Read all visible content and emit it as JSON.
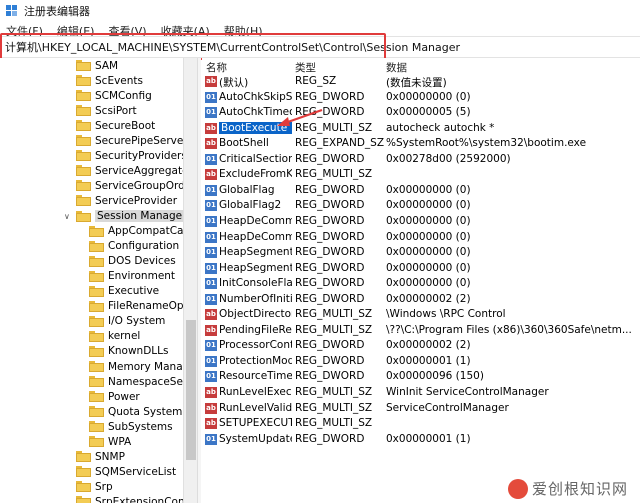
{
  "window": {
    "title": "注册表编辑器"
  },
  "menu": [
    "文件(F)",
    "编辑(E)",
    "查看(V)",
    "收藏夹(A)",
    "帮助(H)"
  ],
  "address": "计算机\\HKEY_LOCAL_MACHINE\\SYSTEM\\CurrentControlSet\\Control\\Session Manager",
  "tree": [
    {
      "label": "SAM",
      "level": 0
    },
    {
      "label": "ScEvents",
      "level": 0
    },
    {
      "label": "SCMConfig",
      "level": 0
    },
    {
      "label": "ScsiPort",
      "level": 0
    },
    {
      "label": "SecureBoot",
      "level": 0
    },
    {
      "label": "SecurePipeServers",
      "level": 0
    },
    {
      "label": "SecurityProviders",
      "level": 0
    },
    {
      "label": "ServiceAggregatedEv",
      "level": 0
    },
    {
      "label": "ServiceGroupOrder",
      "level": 0
    },
    {
      "label": "ServiceProvider",
      "level": 0
    },
    {
      "label": "Session Manager",
      "level": 0,
      "selected": true,
      "expanded": true
    },
    {
      "label": "AppCompatCache",
      "level": 1
    },
    {
      "label": "Configuration Mar",
      "level": 1
    },
    {
      "label": "DOS Devices",
      "level": 1
    },
    {
      "label": "Environment",
      "level": 1
    },
    {
      "label": "Executive",
      "level": 1
    },
    {
      "label": "FileRenameOperat",
      "level": 1
    },
    {
      "label": "I/O System",
      "level": 1
    },
    {
      "label": "kernel",
      "level": 1
    },
    {
      "label": "KnownDLLs",
      "level": 1
    },
    {
      "label": "Memory Managen",
      "level": 1
    },
    {
      "label": "NamespaceSepara",
      "level": 1
    },
    {
      "label": "Power",
      "level": 1
    },
    {
      "label": "Quota System",
      "level": 1
    },
    {
      "label": "SubSystems",
      "level": 1
    },
    {
      "label": "WPA",
      "level": 1
    },
    {
      "label": "SNMP",
      "level": 0
    },
    {
      "label": "SQMServiceList",
      "level": 0
    },
    {
      "label": "Srp",
      "level": 0
    },
    {
      "label": "SrpExtensionConfig",
      "level": 0
    }
  ],
  "columns": {
    "name": "名称",
    "type": "类型",
    "data": "数据"
  },
  "values": [
    {
      "name": "(默认)",
      "type": "REG_SZ",
      "data": "(数值未设置)",
      "icon": "ab"
    },
    {
      "name": "AutoChkSkipSy...",
      "type": "REG_DWORD",
      "data": "0x00000000 (0)",
      "icon": "bin"
    },
    {
      "name": "AutoChkTimeo...",
      "type": "REG_DWORD",
      "data": "0x00000005 (5)",
      "icon": "bin"
    },
    {
      "name": "BootExecute",
      "type": "REG_MULTI_SZ",
      "data": "autocheck autochk *",
      "icon": "ab",
      "selected": true
    },
    {
      "name": "BootShell",
      "type": "REG_EXPAND_SZ",
      "data": "%SystemRoot%\\system32\\bootim.exe",
      "icon": "ab"
    },
    {
      "name": "CriticalSection...",
      "type": "REG_DWORD",
      "data": "0x00278d00 (2592000)",
      "icon": "bin"
    },
    {
      "name": "ExcludeFromK...",
      "type": "REG_MULTI_SZ",
      "data": "",
      "icon": "ab"
    },
    {
      "name": "GlobalFlag",
      "type": "REG_DWORD",
      "data": "0x00000000 (0)",
      "icon": "bin"
    },
    {
      "name": "GlobalFlag2",
      "type": "REG_DWORD",
      "data": "0x00000000 (0)",
      "icon": "bin"
    },
    {
      "name": "HeapDeComm...",
      "type": "REG_DWORD",
      "data": "0x00000000 (0)",
      "icon": "bin"
    },
    {
      "name": "HeapDeComm...",
      "type": "REG_DWORD",
      "data": "0x00000000 (0)",
      "icon": "bin"
    },
    {
      "name": "HeapSegment...",
      "type": "REG_DWORD",
      "data": "0x00000000 (0)",
      "icon": "bin"
    },
    {
      "name": "HeapSegment...",
      "type": "REG_DWORD",
      "data": "0x00000000 (0)",
      "icon": "bin"
    },
    {
      "name": "InitConsoleFlags",
      "type": "REG_DWORD",
      "data": "0x00000000 (0)",
      "icon": "bin"
    },
    {
      "name": "NumberOfIniti...",
      "type": "REG_DWORD",
      "data": "0x00000002 (2)",
      "icon": "bin"
    },
    {
      "name": "ObjectDirector...",
      "type": "REG_MULTI_SZ",
      "data": "\\Windows \\RPC Control",
      "icon": "ab"
    },
    {
      "name": "PendingFileRe...",
      "type": "REG_MULTI_SZ",
      "data": "\\??\\C:\\Program Files (x86)\\360\\360Safe\\netm...",
      "icon": "ab"
    },
    {
      "name": "ProcessorCont...",
      "type": "REG_DWORD",
      "data": "0x00000002 (2)",
      "icon": "bin"
    },
    {
      "name": "ProtectionMode",
      "type": "REG_DWORD",
      "data": "0x00000001 (1)",
      "icon": "bin"
    },
    {
      "name": "ResourceTime...",
      "type": "REG_DWORD",
      "data": "0x00000096 (150)",
      "icon": "bin"
    },
    {
      "name": "RunLevelExecute",
      "type": "REG_MULTI_SZ",
      "data": "WinInit ServiceControlManager",
      "icon": "ab"
    },
    {
      "name": "RunLevelValida...",
      "type": "REG_MULTI_SZ",
      "data": "ServiceControlManager",
      "icon": "ab"
    },
    {
      "name": "SETUPEXECUTE",
      "type": "REG_MULTI_SZ",
      "data": "",
      "icon": "ab"
    },
    {
      "name": "SystemUpdate...",
      "type": "REG_DWORD",
      "data": "0x00000001 (1)",
      "icon": "bin"
    }
  ],
  "watermark": "爱创根知识网",
  "colors": {
    "highlight_red": "#e03b3b",
    "selection_blue": "#0a64c8",
    "folder_yellow": "#f3cc54"
  }
}
